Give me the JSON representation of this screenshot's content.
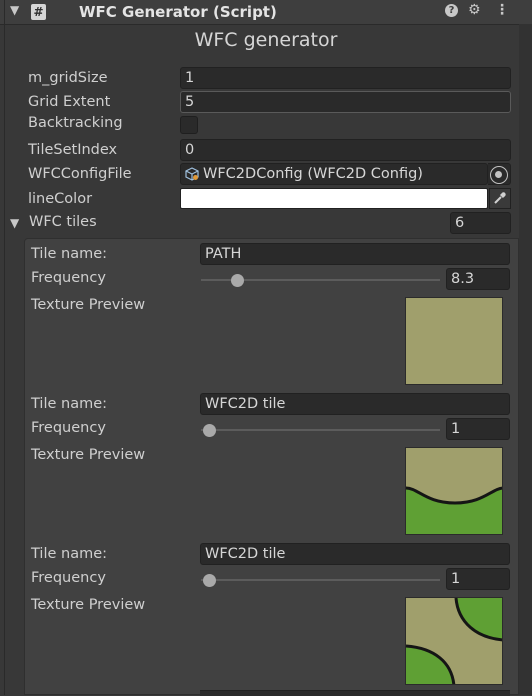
{
  "header": {
    "title": "WFC Generator (Script)",
    "collapse_glyph": "▼",
    "script_icon_glyph": "#",
    "help_glyph": "?",
    "settings_glyph": "⚙",
    "menu_glyph": "⋮"
  },
  "inspector": {
    "heading": "WFC generator",
    "fields": {
      "grid_size": {
        "label": "m_gridSize",
        "value": "1"
      },
      "grid_extent": {
        "label": "Grid Extent",
        "value": "5"
      },
      "backtracking": {
        "label": "Backtracking",
        "checked": false
      },
      "tile_set_index": {
        "label": "TileSetIndex",
        "value": "0"
      },
      "config_file": {
        "label": "WFCConfigFile",
        "value": "WFC2DConfig (WFC2D Config)"
      },
      "line_color": {
        "label": "lineColor",
        "color": "#ffffff"
      }
    },
    "tiles": {
      "label": "WFC tiles",
      "count": "6",
      "foldout_glyph": "▼",
      "items": [
        {
          "name_label": "Tile name:",
          "name": "PATH",
          "frequency_label": "Frequency",
          "frequency": "8.3",
          "frequency_fraction": 0.12,
          "preview_label": "Texture Preview"
        },
        {
          "name_label": "Tile name:",
          "name": "WFC2D tile",
          "frequency_label": "Frequency",
          "frequency": "1",
          "frequency_fraction": 0.0,
          "preview_label": "Texture Preview"
        },
        {
          "name_label": "Tile name:",
          "name": "WFC2D tile",
          "frequency_label": "Frequency",
          "frequency": "1",
          "frequency_fraction": 0.0,
          "preview_label": "Texture Preview"
        }
      ]
    }
  },
  "colors": {
    "sand": "#a09f6c",
    "grass": "#5fa034",
    "outline": "#151515",
    "background": "#383838"
  }
}
